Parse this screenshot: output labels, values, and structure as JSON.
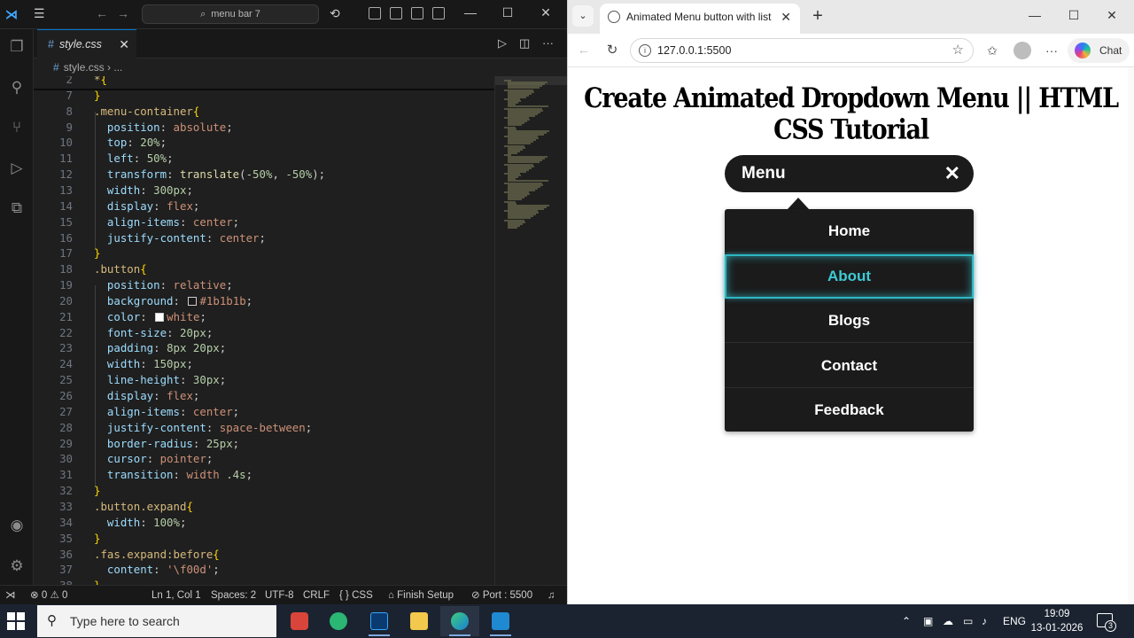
{
  "vscode": {
    "title_search": "menu bar 7",
    "tab": {
      "label": "style.css"
    },
    "breadcrumb": {
      "file": "style.css",
      "more": "..."
    },
    "lines": [
      [
        {
          "t": "*",
          "c": "sel"
        },
        {
          "t": "{",
          "c": "brace"
        }
      ],
      [
        {
          "t": "}",
          "c": "brace"
        }
      ],
      [
        {
          "t": ".menu-container",
          "c": "sel"
        },
        {
          "t": "{",
          "c": "brace"
        }
      ],
      [
        {
          "t": "  position",
          "c": "prop"
        },
        {
          "t": ": ",
          "c": "punc"
        },
        {
          "t": "absolute",
          "c": "val"
        },
        {
          "t": ";",
          "c": "punc"
        }
      ],
      [
        {
          "t": "  top",
          "c": "prop"
        },
        {
          "t": ": ",
          "c": "punc"
        },
        {
          "t": "20%",
          "c": "num"
        },
        {
          "t": ";",
          "c": "punc"
        }
      ],
      [
        {
          "t": "  left",
          "c": "prop"
        },
        {
          "t": ": ",
          "c": "punc"
        },
        {
          "t": "50%",
          "c": "num"
        },
        {
          "t": ";",
          "c": "punc"
        }
      ],
      [
        {
          "t": "  transform",
          "c": "prop"
        },
        {
          "t": ": ",
          "c": "punc"
        },
        {
          "t": "translate",
          "c": "fn"
        },
        {
          "t": "(",
          "c": "punc"
        },
        {
          "t": "-50%",
          "c": "num"
        },
        {
          "t": ", ",
          "c": "punc"
        },
        {
          "t": "-50%",
          "c": "num"
        },
        {
          "t": ");",
          "c": "punc"
        }
      ],
      [
        {
          "t": "  width",
          "c": "prop"
        },
        {
          "t": ": ",
          "c": "punc"
        },
        {
          "t": "300px",
          "c": "num"
        },
        {
          "t": ";",
          "c": "punc"
        }
      ],
      [
        {
          "t": "  display",
          "c": "prop"
        },
        {
          "t": ": ",
          "c": "punc"
        },
        {
          "t": "flex",
          "c": "val"
        },
        {
          "t": ";",
          "c": "punc"
        }
      ],
      [
        {
          "t": "  align-items",
          "c": "prop"
        },
        {
          "t": ": ",
          "c": "punc"
        },
        {
          "t": "center",
          "c": "val"
        },
        {
          "t": ";",
          "c": "punc"
        }
      ],
      [
        {
          "t": "  justify-content",
          "c": "prop"
        },
        {
          "t": ": ",
          "c": "punc"
        },
        {
          "t": "center",
          "c": "val"
        },
        {
          "t": ";",
          "c": "punc"
        }
      ],
      [
        {
          "t": "}",
          "c": "brace"
        }
      ],
      [
        {
          "t": ".button",
          "c": "sel"
        },
        {
          "t": "{",
          "c": "brace"
        }
      ],
      [
        {
          "t": "  position",
          "c": "prop"
        },
        {
          "t": ": ",
          "c": "punc"
        },
        {
          "t": "relative",
          "c": "val"
        },
        {
          "t": ";",
          "c": "punc"
        }
      ],
      [
        {
          "t": "  background",
          "c": "prop"
        },
        {
          "t": ": ",
          "c": "punc"
        },
        {
          "sq": "#1b1b1b"
        },
        {
          "t": "#1b1b1b",
          "c": "val"
        },
        {
          "t": ";",
          "c": "punc"
        }
      ],
      [
        {
          "t": "  color",
          "c": "prop"
        },
        {
          "t": ": ",
          "c": "punc"
        },
        {
          "sq": "#ffffff"
        },
        {
          "t": "white",
          "c": "val"
        },
        {
          "t": ";",
          "c": "punc"
        }
      ],
      [
        {
          "t": "  font-size",
          "c": "prop"
        },
        {
          "t": ": ",
          "c": "punc"
        },
        {
          "t": "20px",
          "c": "num"
        },
        {
          "t": ";",
          "c": "punc"
        }
      ],
      [
        {
          "t": "  padding",
          "c": "prop"
        },
        {
          "t": ": ",
          "c": "punc"
        },
        {
          "t": "8px 20px",
          "c": "num"
        },
        {
          "t": ";",
          "c": "punc"
        }
      ],
      [
        {
          "t": "  width",
          "c": "prop"
        },
        {
          "t": ": ",
          "c": "punc"
        },
        {
          "t": "150px",
          "c": "num"
        },
        {
          "t": ";",
          "c": "punc"
        }
      ],
      [
        {
          "t": "  line-height",
          "c": "prop"
        },
        {
          "t": ": ",
          "c": "punc"
        },
        {
          "t": "30px",
          "c": "num"
        },
        {
          "t": ";",
          "c": "punc"
        }
      ],
      [
        {
          "t": "  display",
          "c": "prop"
        },
        {
          "t": ": ",
          "c": "punc"
        },
        {
          "t": "flex",
          "c": "val"
        },
        {
          "t": ";",
          "c": "punc"
        }
      ],
      [
        {
          "t": "  align-items",
          "c": "prop"
        },
        {
          "t": ": ",
          "c": "punc"
        },
        {
          "t": "center",
          "c": "val"
        },
        {
          "t": ";",
          "c": "punc"
        }
      ],
      [
        {
          "t": "  justify-content",
          "c": "prop"
        },
        {
          "t": ": ",
          "c": "punc"
        },
        {
          "t": "space-between",
          "c": "val"
        },
        {
          "t": ";",
          "c": "punc"
        }
      ],
      [
        {
          "t": "  border-radius",
          "c": "prop"
        },
        {
          "t": ": ",
          "c": "punc"
        },
        {
          "t": "25px",
          "c": "num"
        },
        {
          "t": ";",
          "c": "punc"
        }
      ],
      [
        {
          "t": "  cursor",
          "c": "prop"
        },
        {
          "t": ": ",
          "c": "punc"
        },
        {
          "t": "pointer",
          "c": "val"
        },
        {
          "t": ";",
          "c": "punc"
        }
      ],
      [
        {
          "t": "  transition",
          "c": "prop"
        },
        {
          "t": ": ",
          "c": "punc"
        },
        {
          "t": "width ",
          "c": "val"
        },
        {
          "t": ".4s",
          "c": "num"
        },
        {
          "t": ";",
          "c": "punc"
        }
      ],
      [
        {
          "t": "}",
          "c": "brace"
        }
      ],
      [
        {
          "t": ".button.expand",
          "c": "sel"
        },
        {
          "t": "{",
          "c": "brace"
        }
      ],
      [
        {
          "t": "  width",
          "c": "prop"
        },
        {
          "t": ": ",
          "c": "punc"
        },
        {
          "t": "100%",
          "c": "num"
        },
        {
          "t": ";",
          "c": "punc"
        }
      ],
      [
        {
          "t": "}",
          "c": "brace"
        }
      ],
      [
        {
          "t": ".fas.expand:before",
          "c": "sel"
        },
        {
          "t": "{",
          "c": "brace"
        }
      ],
      [
        {
          "t": "  content",
          "c": "prop"
        },
        {
          "t": ": ",
          "c": "punc"
        },
        {
          "t": "'\\f00d'",
          "c": "val"
        },
        {
          "t": ";",
          "c": "punc"
        }
      ],
      [
        {
          "t": "}",
          "c": "brace"
        }
      ]
    ],
    "line_numbers": [
      "2",
      "7",
      "8",
      "9",
      "10",
      "11",
      "12",
      "13",
      "14",
      "15",
      "16",
      "17",
      "18",
      "19",
      "20",
      "21",
      "22",
      "23",
      "24",
      "25",
      "26",
      "27",
      "28",
      "29",
      "30",
      "31",
      "32",
      "33",
      "34",
      "35",
      "36",
      "37",
      "38"
    ],
    "status": {
      "errors": "0",
      "warnings": "0",
      "position": "Ln 1, Col 1",
      "spaces": "Spaces: 2",
      "encoding": "UTF-8",
      "eol": "CRLF",
      "language": "CSS",
      "language_icon": "{ }",
      "finish_setup": "Finish Setup",
      "port": "Port : 5500"
    }
  },
  "browser": {
    "tab_title": "Animated Menu button with list",
    "url": "127.0.0.1:5500",
    "chat_label": "Chat",
    "page": {
      "heading": "Create Animated Dropdown Menu || HTML CSS Tutorial",
      "menu_button_label": "Menu",
      "menu_close_icon": "✕",
      "items": [
        "Home",
        "About",
        "Blogs",
        "Contact",
        "Feedback"
      ],
      "active_item": "About",
      "accent_color": "#3ec9d6"
    }
  },
  "taskbar": {
    "search_placeholder": "Type here to search",
    "language": "ENG",
    "time": "19:09",
    "date": "13-01-2026",
    "notification_count": "3"
  }
}
